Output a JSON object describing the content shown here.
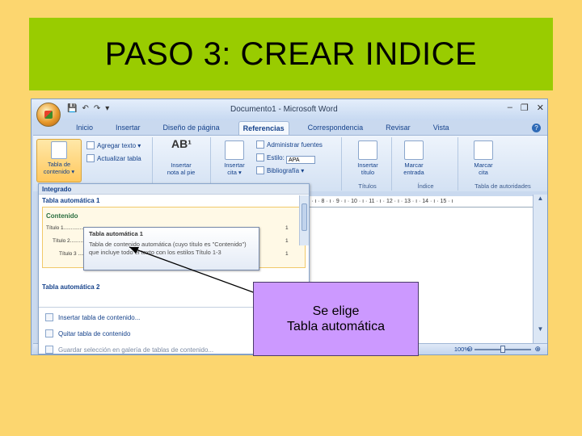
{
  "slide": {
    "title": "PASO 3: CREAR INDICE",
    "banner_color": "#99cc00",
    "background_color": "#fcd66f",
    "callout": {
      "line1": "Se elige",
      "line2": "Tabla automática",
      "color": "#cc99ff"
    }
  },
  "window": {
    "title": "Documento1 - Microsoft Word",
    "quick_access": [
      "save-icon",
      "undo-icon",
      "redo-icon",
      "customize-icon"
    ],
    "controls": [
      "minimize-icon",
      "restore-icon",
      "close-icon"
    ]
  },
  "tabs": [
    {
      "label": "Inicio",
      "active": false
    },
    {
      "label": "Insertar",
      "active": false
    },
    {
      "label": "Diseño de página",
      "active": false
    },
    {
      "label": "Referencias",
      "active": true
    },
    {
      "label": "Correspondencia",
      "active": false
    },
    {
      "label": "Revisar",
      "active": false
    },
    {
      "label": "Vista",
      "active": false
    }
  ],
  "ribbon": {
    "tdc": {
      "big_button_line1": "Tabla de",
      "big_button_line2": "contenido ▾",
      "agregar_texto": "Agregar texto ▾",
      "actualizar_tabla": "Actualizar tabla"
    },
    "notas": {
      "insertar_nota_line1": "Insertar",
      "insertar_nota_line2": "nota al pie"
    },
    "citas": {
      "insertar_cita_line1": "Insertar",
      "insertar_cita_line2": "cita ▾",
      "administrar_fuentes": "Administrar fuentes",
      "estilo_label": "Estilo:",
      "estilo_value": "APA",
      "bibliografia": "Bibliografía ▾",
      "group_label": "as"
    },
    "titulos": {
      "insertar_titulo_line1": "Insertar",
      "insertar_titulo_line2": "título",
      "group_label": "Títulos"
    },
    "indice": {
      "marcar_entrada_line1": "Marcar",
      "marcar_entrada_line2": "entrada",
      "group_label": "Índice"
    },
    "autoridades": {
      "marcar_cita_line1": "Marcar",
      "marcar_cita_line2": "cita",
      "group_label": "Tabla de autoridades"
    }
  },
  "ruler_text": "· 7 · ı · 8 · ı · 9 · ı · 10 · ı · 11 · ı · 12 · ı · 13 · ı · 14 · ı · 15 · ı",
  "dropdown": {
    "header": "Integrado",
    "item1_title": "Tabla automática 1",
    "preview": {
      "heading": "Contenido",
      "lines": [
        {
          "label": "Título 1..............",
          "page": "1"
        },
        {
          "label": "Título 2..........",
          "page": "1"
        },
        {
          "label": "Título 3 ......",
          "page": "1"
        }
      ]
    },
    "item2_title": "Tabla automática 2",
    "commands": [
      {
        "label": "Insertar tabla de contenido...",
        "enabled": true
      },
      {
        "label": "Quitar tabla de contenido",
        "enabled": true
      },
      {
        "label": "Guardar selección en galería de tablas de contenido...",
        "enabled": false
      }
    ]
  },
  "tooltip": {
    "title": "Tabla automática 1",
    "body": "Tabla de contenido automática (cuyo título es \"Contenido\") que incluye todo el texto con los estilos Título 1-3"
  },
  "status": {
    "zoom": "100%"
  }
}
